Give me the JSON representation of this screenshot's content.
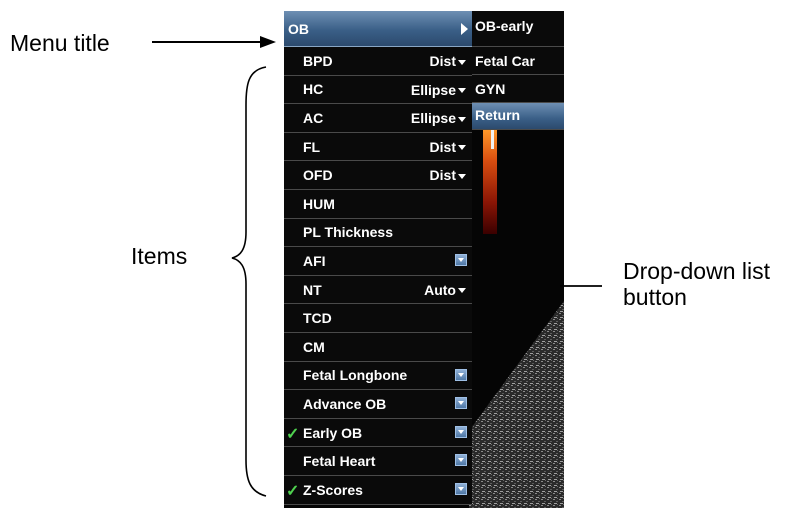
{
  "callouts": {
    "menu_title": "Menu title",
    "items": "Items",
    "dropdown_line1": "Drop-down list",
    "dropdown_line2": "button"
  },
  "menu": {
    "title": "OB",
    "items": [
      {
        "label": "BPD",
        "method": "Dist",
        "control": "dropdown",
        "checked": false
      },
      {
        "label": "HC",
        "method": "Ellipse",
        "control": "dropdown",
        "checked": false
      },
      {
        "label": "AC",
        "method": "Ellipse",
        "control": "dropdown",
        "checked": false
      },
      {
        "label": "FL",
        "method": "Dist",
        "control": "dropdown",
        "checked": false
      },
      {
        "label": "OFD",
        "method": "Dist",
        "control": "dropdown",
        "checked": false
      },
      {
        "label": "HUM",
        "method": "",
        "control": "none",
        "checked": false
      },
      {
        "label": "PL Thickness",
        "method": "",
        "control": "none",
        "checked": false
      },
      {
        "label": "AFI",
        "method": "",
        "control": "expand",
        "checked": false
      },
      {
        "label": "NT",
        "method": "Auto",
        "control": "dropdown",
        "checked": false
      },
      {
        "label": "TCD",
        "method": "",
        "control": "none",
        "checked": false
      },
      {
        "label": "CM",
        "method": "",
        "control": "none",
        "checked": false
      },
      {
        "label": "Fetal Longbone",
        "method": "",
        "control": "expand",
        "checked": false
      },
      {
        "label": "Advance OB",
        "method": "",
        "control": "expand",
        "checked": false
      },
      {
        "label": "Early OB",
        "method": "",
        "control": "expand",
        "checked": true
      },
      {
        "label": "Fetal Heart",
        "method": "",
        "control": "expand",
        "checked": false
      },
      {
        "label": "Z-Scores",
        "method": "",
        "control": "expand",
        "checked": true
      }
    ]
  },
  "submenu": {
    "items": [
      "OB-early",
      "Fetal Car",
      "GYN"
    ],
    "return_label": "Return"
  },
  "colors": {
    "menu_bg": "#0a0a0a",
    "title_blue": "#3a5f87",
    "check_green": "#4fd14f",
    "expand_blue": "#4f78a6"
  }
}
